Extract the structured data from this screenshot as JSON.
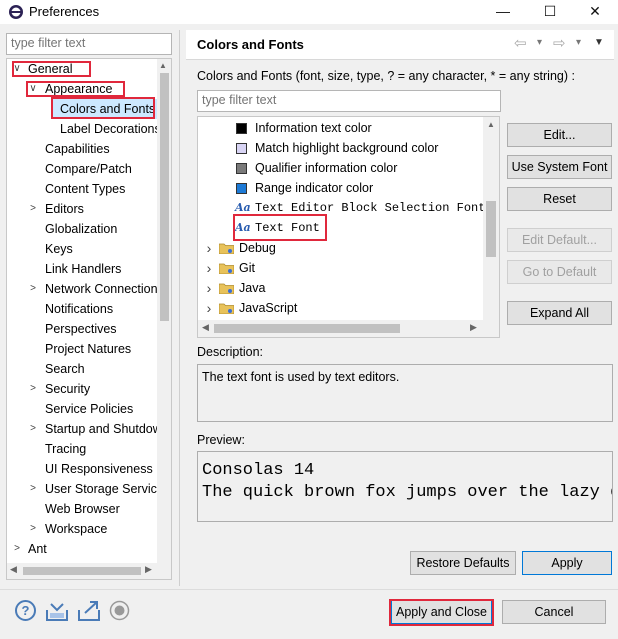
{
  "window": {
    "title": "Preferences",
    "controls": {
      "minimize": "—",
      "maximize": "☐",
      "close": "✕"
    }
  },
  "sidebar": {
    "filter_placeholder": "type filter text",
    "items": [
      {
        "label": "General",
        "twisty": "∨"
      },
      {
        "label": "Appearance",
        "twisty": "∨"
      },
      {
        "label": "Colors and Fonts",
        "twisty": ""
      },
      {
        "label": "Label Decorations",
        "twisty": ""
      },
      {
        "label": "Capabilities",
        "twisty": ""
      },
      {
        "label": "Compare/Patch",
        "twisty": ""
      },
      {
        "label": "Content Types",
        "twisty": ""
      },
      {
        "label": "Editors",
        "twisty": ">"
      },
      {
        "label": "Globalization",
        "twisty": ""
      },
      {
        "label": "Keys",
        "twisty": ""
      },
      {
        "label": "Link Handlers",
        "twisty": ""
      },
      {
        "label": "Network Connections",
        "twisty": ">"
      },
      {
        "label": "Notifications",
        "twisty": ""
      },
      {
        "label": "Perspectives",
        "twisty": ""
      },
      {
        "label": "Project Natures",
        "twisty": ""
      },
      {
        "label": "Search",
        "twisty": ""
      },
      {
        "label": "Security",
        "twisty": ">"
      },
      {
        "label": "Service Policies",
        "twisty": ""
      },
      {
        "label": "Startup and Shutdown",
        "twisty": ">"
      },
      {
        "label": "Tracing",
        "twisty": ""
      },
      {
        "label": "UI Responsiveness",
        "twisty": ""
      },
      {
        "label": "User Storage Service",
        "twisty": ">"
      },
      {
        "label": "Web Browser",
        "twisty": ""
      },
      {
        "label": "Workspace",
        "twisty": ">"
      },
      {
        "label": "Ant",
        "twisty": ">"
      }
    ]
  },
  "main": {
    "title": "Colors and Fonts",
    "nav": {
      "back": "⇦",
      "forward": "⇨",
      "dropdown": "▾",
      "menu": "▼"
    },
    "description_label": "Colors and Fonts (font, size, type, ? = any character, * = any string) :",
    "filter_placeholder": "type filter text",
    "tree_items": [
      {
        "label": "Information text color",
        "icon": "color-swatch",
        "color": "#000000"
      },
      {
        "label": "Match highlight background color",
        "icon": "color-swatch",
        "color": "#d8d4f4"
      },
      {
        "label": "Qualifier information color",
        "icon": "color-swatch",
        "color": "#7a7a7a"
      },
      {
        "label": "Range indicator color",
        "icon": "color-swatch",
        "color": "#1d7ad6"
      },
      {
        "label": "Text Editor Block Selection Font",
        "icon": "font",
        "glyph": "Aa"
      },
      {
        "label": "Text Font",
        "icon": "font",
        "glyph": "Aa"
      },
      {
        "label": "Debug",
        "icon": "folder"
      },
      {
        "label": "Git",
        "icon": "folder"
      },
      {
        "label": "Java",
        "icon": "folder"
      },
      {
        "label": "JavaScript",
        "icon": "folder"
      }
    ],
    "buttons": {
      "edit": "Edit...",
      "use_system_font": "Use System Font",
      "reset": "Reset",
      "edit_default": "Edit Default...",
      "go_to_default": "Go to Default",
      "expand_all": "Expand All"
    },
    "description": {
      "label": "Description:",
      "text": "The text font is used by text editors."
    },
    "preview": {
      "label": "Preview:",
      "line1": "Consolas 14",
      "line2": "The quick brown fox jumps over the lazy d"
    },
    "restore_defaults": "Restore Defaults",
    "apply": "Apply"
  },
  "footer": {
    "help": "?",
    "apply_and_close": "Apply and Close",
    "cancel": "Cancel"
  },
  "colors": {
    "highlight_box": "#e0283c",
    "selection": "#cce8ff",
    "accent": "#0078d7"
  }
}
